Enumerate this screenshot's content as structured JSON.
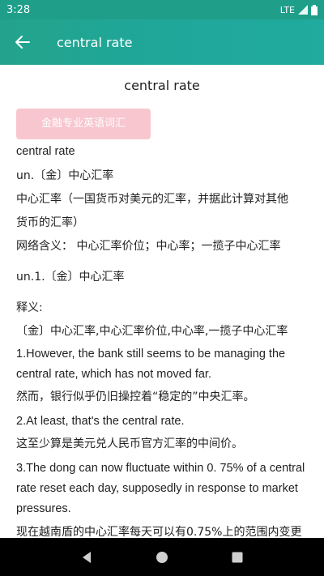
{
  "status": {
    "time": "3:28",
    "network": "LTE"
  },
  "appbar": {
    "title": "central rate"
  },
  "entry": {
    "headword": "central rate",
    "badge": "金融专业英语词汇",
    "term": "central rate",
    "pos_def": "un.〔金〕中心汇率",
    "def_line1": "中心汇率（一国货币对美元的汇率，并据此计算对其他",
    "def_line2": "货币的汇率）",
    "web_meaning": "网络含义： 中心汇率价位；中心率；一揽子中心汇率",
    "sense1": "un.1.〔金〕中心汇率",
    "gloss_label": "释义:",
    "gloss": "〔金〕中心汇率,中心汇率价位,中心率,一揽子中心汇率",
    "ex1_en_1": "1.However, the bank still seems to be managing the",
    "ex1_en_2": "central rate, which has not moved far.",
    "ex1_zh": "然而，银行似乎仍旧操控着“稳定的”中央汇率。",
    "ex2_en": "2.At least, that's the central rate.",
    "ex2_zh": "这至少算是美元兑人民币官方汇率的中间价。",
    "ex3_en_1": "3.The dong can now fluctuate within 0. 75% of a central",
    "ex3_en_2": "rate reset each day, supposedly in response to market",
    "ex3_en_3": "pressures.",
    "ex3_zh_partial": "现在越南盾的中心汇率每天可以有0.75%上的范围内变更"
  },
  "colors": {
    "primary": "#1fa79a",
    "badge": "#f8c6cf"
  },
  "icons": {
    "back": "arrow-left-icon",
    "nav_back": "triangle-back-icon",
    "nav_home": "circle-home-icon",
    "nav_recents": "square-recents-icon"
  }
}
